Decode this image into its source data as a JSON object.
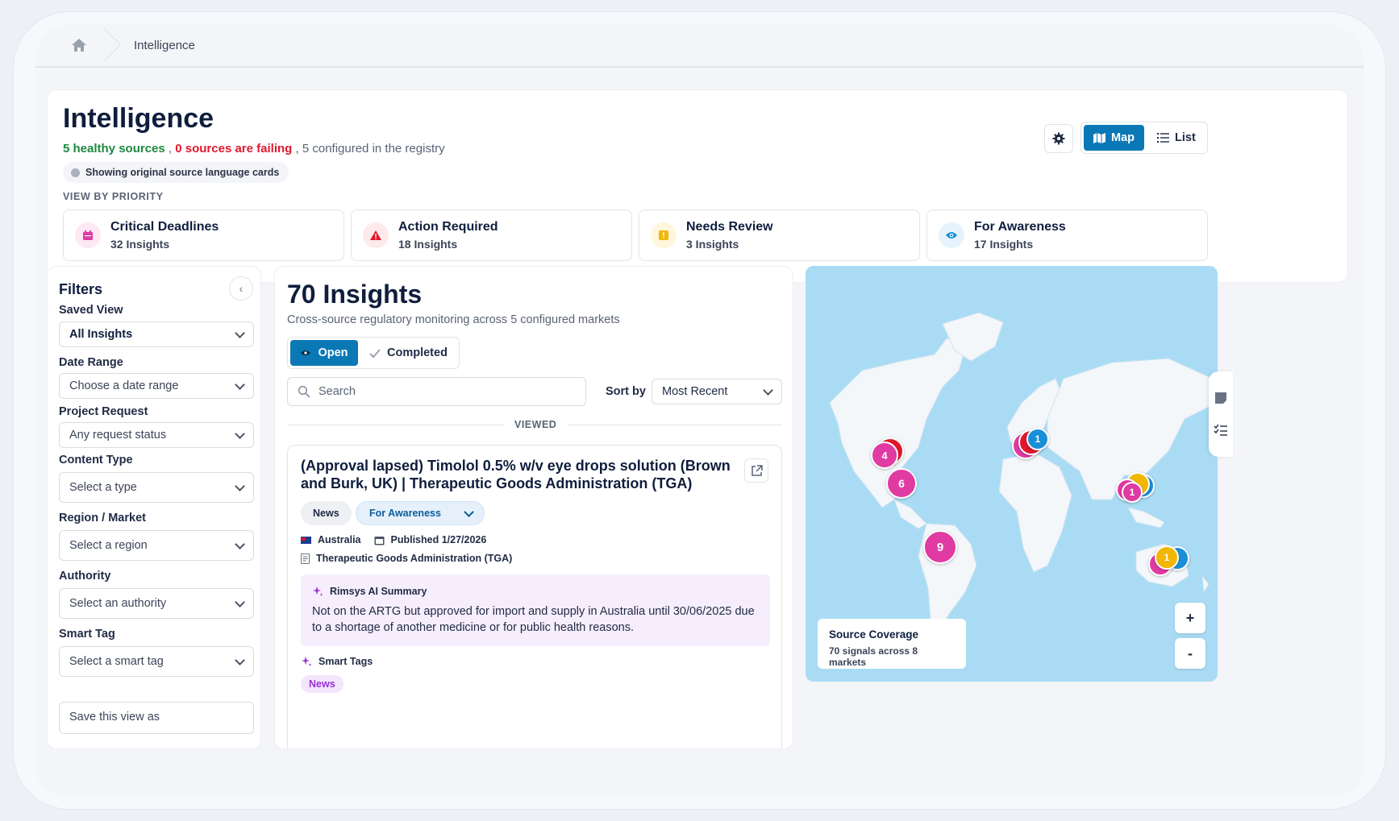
{
  "breadcrumb": {
    "home_icon": "home-icon",
    "current": "Intelligence"
  },
  "header": {
    "title": "Intelligence",
    "status": {
      "healthy": "5 healthy sources",
      "sep1": " , ",
      "failing": "0 sources are failing",
      "sep2": " , ",
      "configured": "5 configured in the registry"
    },
    "language_note": "Showing original source language cards",
    "view_by_label": "VIEW BY PRIORITY",
    "settings_icon": "gear-icon",
    "view_toggle": {
      "map_label": "Map",
      "list_label": "List",
      "active": "Map"
    },
    "priorities": [
      {
        "title": "Critical Deadlines",
        "count": "32 Insights",
        "icon": "calendar-icon",
        "color": "#e03aa3",
        "bg": "#fde8f4"
      },
      {
        "title": "Action Required",
        "count": "18 Insights",
        "icon": "warning-icon",
        "color": "#e0182d",
        "bg": "#fdeaea"
      },
      {
        "title": "Needs Review",
        "count": "3 Insights",
        "icon": "exclamation-icon",
        "color": "#f2b705",
        "bg": "#fff6dc"
      },
      {
        "title": "For Awareness",
        "count": "17 Insights",
        "icon": "eye-icon",
        "color": "#1a8fd8",
        "bg": "#e6f3fc"
      }
    ]
  },
  "filters": {
    "title": "Filters",
    "saved_view": {
      "label": "Saved View",
      "value": "All Insights"
    },
    "date_range": {
      "label": "Date Range",
      "value": "Choose a date range"
    },
    "project_request": {
      "label": "Project Request",
      "value": "Any request status"
    },
    "content_type": {
      "label": "Content Type",
      "value": "Select a type"
    },
    "region": {
      "label": "Region / Market",
      "value": "Select a region"
    },
    "authority": {
      "label": "Authority",
      "value": "Select an authority"
    },
    "smart_tag": {
      "label": "Smart Tag",
      "value": "Select a smart tag"
    },
    "save_view": "Save this view as"
  },
  "insights": {
    "title": "70 Insights",
    "subtitle": "Cross-source regulatory monitoring across 5 configured markets",
    "tabs": {
      "open": "Open",
      "completed": "Completed",
      "active": "Open"
    },
    "search_placeholder": "Search",
    "sort_label": "Sort by",
    "sort_value": "Most Recent",
    "divider_label": "VIEWED",
    "card": {
      "title": "(Approval lapsed) Timolol 0.5% w/v eye drops solution (Brown and Burk, UK) | Therapeutic Goods Administration (TGA)",
      "tag": "News",
      "priority": "For Awareness",
      "country": "Australia",
      "published": "Published 1/27/2026",
      "source": "Therapeutic Goods Administration (TGA)",
      "ai_heading": "Rimsys AI Summary",
      "ai_summary": "Not on the ARTG but approved for import and supply in Australia until 30/06/2025 due to a shortage of another medicine or for public health reasons.",
      "smart_tags_heading": "Smart Tags",
      "smart_tags": [
        "News"
      ]
    }
  },
  "map": {
    "clusters": [
      {
        "label": "4",
        "color": "#e03aa3"
      },
      {
        "label": "6",
        "color": "#e03aa3"
      },
      {
        "label": "1",
        "color": "#1a8fd8"
      },
      {
        "label": "1",
        "color": "#e03aa3"
      },
      {
        "label": "9",
        "color": "#e03aa3"
      },
      {
        "label": "1",
        "color": "#f2b705"
      }
    ],
    "zoom_in": "+",
    "zoom_out": "-",
    "coverage_title": "Source Coverage",
    "coverage_sub": "70 signals across 8 markets"
  }
}
